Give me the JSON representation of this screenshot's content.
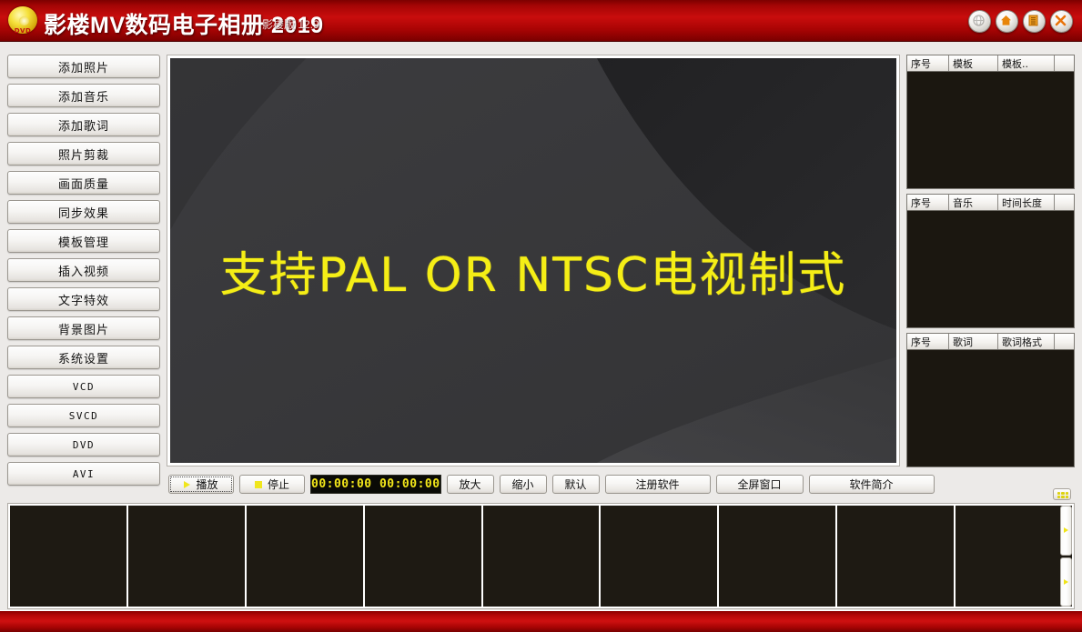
{
  "titlebar": {
    "logo_icon": "dvd-disc-icon",
    "logo_text": "DVD",
    "title": "影楼MV数码电子相册 2019",
    "subtitle": "影楼版 12.9",
    "buttons": [
      {
        "name": "minimize-button",
        "icon": "globe-icon"
      },
      {
        "name": "home-button",
        "icon": "home-icon"
      },
      {
        "name": "menu-button",
        "icon": "document-list-icon"
      },
      {
        "name": "close-button",
        "icon": "close-x-icon"
      }
    ],
    "accent_color": "#c90d0d"
  },
  "sidebar": {
    "items": [
      {
        "label": "添加照片",
        "latin": false
      },
      {
        "label": "添加音乐",
        "latin": false
      },
      {
        "label": "添加歌词",
        "latin": false
      },
      {
        "label": "照片剪裁",
        "latin": false
      },
      {
        "label": "画面质量",
        "latin": false
      },
      {
        "label": "同步效果",
        "latin": false
      },
      {
        "label": "模板管理",
        "latin": false
      },
      {
        "label": "插入视频",
        "latin": false
      },
      {
        "label": "文字特效",
        "latin": false
      },
      {
        "label": "背景图片",
        "latin": false
      },
      {
        "label": "系统设置",
        "latin": false
      },
      {
        "label": "VCD",
        "latin": true
      },
      {
        "label": "SVCD",
        "latin": true
      },
      {
        "label": "DVD",
        "latin": true
      },
      {
        "label": "AVI",
        "latin": true
      }
    ]
  },
  "preview": {
    "overlay_text": "支持PAL OR NTSC电视制式",
    "text_color": "#f5ee16",
    "background_color": "#37373a"
  },
  "toolbar": {
    "play_label": "播放",
    "play_icon": "play-triangle-icon",
    "stop_label": "停止",
    "stop_icon": "stop-square-icon",
    "timecode": "00:00:00 00:00:00",
    "zoom_in_label": "放大",
    "zoom_out_label": "缩小",
    "default_label": "默认",
    "register_label": "注册软件",
    "fullscreen_label": "全屏窗口",
    "about_label": "软件简介"
  },
  "panels": [
    {
      "name": "template-panel",
      "columns": [
        "序号",
        "模板",
        "模板.."
      ],
      "rows": []
    },
    {
      "name": "music-panel",
      "columns": [
        "序号",
        "音乐",
        "时间长度"
      ],
      "rows": []
    },
    {
      "name": "lyrics-panel",
      "columns": [
        "序号",
        "歌词",
        "歌词格式"
      ],
      "rows": []
    }
  ],
  "thumbnail_strip": {
    "thumbnail_count": 9,
    "thumbnail_color": "#1e1a13",
    "scroll_up_icon": "scroll-arrow-icon",
    "scroll_down_icon": "scroll-arrow-icon",
    "grip_icon": "grip-dots-icon"
  }
}
